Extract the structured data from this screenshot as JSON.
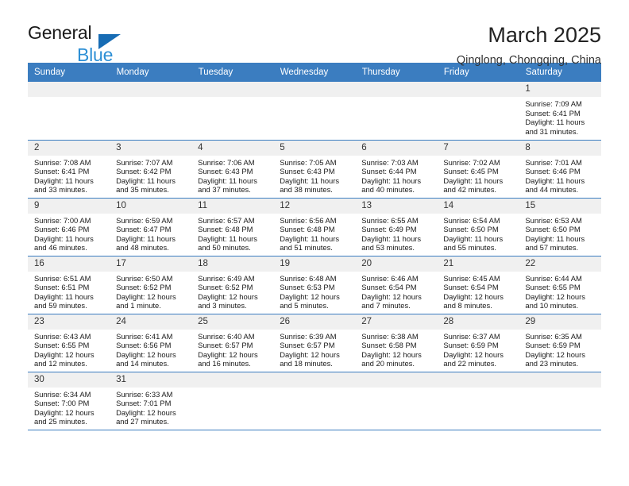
{
  "brand": {
    "name_part1": "General",
    "name_part2": "Blue",
    "accent_color": "#2d8fd5",
    "triangle_color": "#176cb4"
  },
  "header": {
    "title": "March 2025",
    "subtitle": "Qinglong, Chongqing, China"
  },
  "theme": {
    "header_band": "#3b7dc0",
    "daynum_bg": "#f0f0f0",
    "row_border": "#3b7dc0"
  },
  "weekdays": [
    "Sunday",
    "Monday",
    "Tuesday",
    "Wednesday",
    "Thursday",
    "Friday",
    "Saturday"
  ],
  "labels": {
    "sunrise": "Sunrise:",
    "sunset": "Sunset:",
    "daylight": "Daylight:"
  },
  "weeks": [
    [
      {
        "day": "",
        "blank": true
      },
      {
        "day": "",
        "blank": true
      },
      {
        "day": "",
        "blank": true
      },
      {
        "day": "",
        "blank": true
      },
      {
        "day": "",
        "blank": true
      },
      {
        "day": "",
        "blank": true
      },
      {
        "day": "1",
        "sunrise": "Sunrise: 7:09 AM",
        "sunset": "Sunset: 6:41 PM",
        "daylight1": "Daylight: 11 hours",
        "daylight2": "and 31 minutes."
      }
    ],
    [
      {
        "day": "2",
        "sunrise": "Sunrise: 7:08 AM",
        "sunset": "Sunset: 6:41 PM",
        "daylight1": "Daylight: 11 hours",
        "daylight2": "and 33 minutes."
      },
      {
        "day": "3",
        "sunrise": "Sunrise: 7:07 AM",
        "sunset": "Sunset: 6:42 PM",
        "daylight1": "Daylight: 11 hours",
        "daylight2": "and 35 minutes."
      },
      {
        "day": "4",
        "sunrise": "Sunrise: 7:06 AM",
        "sunset": "Sunset: 6:43 PM",
        "daylight1": "Daylight: 11 hours",
        "daylight2": "and 37 minutes."
      },
      {
        "day": "5",
        "sunrise": "Sunrise: 7:05 AM",
        "sunset": "Sunset: 6:43 PM",
        "daylight1": "Daylight: 11 hours",
        "daylight2": "and 38 minutes."
      },
      {
        "day": "6",
        "sunrise": "Sunrise: 7:03 AM",
        "sunset": "Sunset: 6:44 PM",
        "daylight1": "Daylight: 11 hours",
        "daylight2": "and 40 minutes."
      },
      {
        "day": "7",
        "sunrise": "Sunrise: 7:02 AM",
        "sunset": "Sunset: 6:45 PM",
        "daylight1": "Daylight: 11 hours",
        "daylight2": "and 42 minutes."
      },
      {
        "day": "8",
        "sunrise": "Sunrise: 7:01 AM",
        "sunset": "Sunset: 6:46 PM",
        "daylight1": "Daylight: 11 hours",
        "daylight2": "and 44 minutes."
      }
    ],
    [
      {
        "day": "9",
        "sunrise": "Sunrise: 7:00 AM",
        "sunset": "Sunset: 6:46 PM",
        "daylight1": "Daylight: 11 hours",
        "daylight2": "and 46 minutes."
      },
      {
        "day": "10",
        "sunrise": "Sunrise: 6:59 AM",
        "sunset": "Sunset: 6:47 PM",
        "daylight1": "Daylight: 11 hours",
        "daylight2": "and 48 minutes."
      },
      {
        "day": "11",
        "sunrise": "Sunrise: 6:57 AM",
        "sunset": "Sunset: 6:48 PM",
        "daylight1": "Daylight: 11 hours",
        "daylight2": "and 50 minutes."
      },
      {
        "day": "12",
        "sunrise": "Sunrise: 6:56 AM",
        "sunset": "Sunset: 6:48 PM",
        "daylight1": "Daylight: 11 hours",
        "daylight2": "and 51 minutes."
      },
      {
        "day": "13",
        "sunrise": "Sunrise: 6:55 AM",
        "sunset": "Sunset: 6:49 PM",
        "daylight1": "Daylight: 11 hours",
        "daylight2": "and 53 minutes."
      },
      {
        "day": "14",
        "sunrise": "Sunrise: 6:54 AM",
        "sunset": "Sunset: 6:50 PM",
        "daylight1": "Daylight: 11 hours",
        "daylight2": "and 55 minutes."
      },
      {
        "day": "15",
        "sunrise": "Sunrise: 6:53 AM",
        "sunset": "Sunset: 6:50 PM",
        "daylight1": "Daylight: 11 hours",
        "daylight2": "and 57 minutes."
      }
    ],
    [
      {
        "day": "16",
        "sunrise": "Sunrise: 6:51 AM",
        "sunset": "Sunset: 6:51 PM",
        "daylight1": "Daylight: 11 hours",
        "daylight2": "and 59 minutes."
      },
      {
        "day": "17",
        "sunrise": "Sunrise: 6:50 AM",
        "sunset": "Sunset: 6:52 PM",
        "daylight1": "Daylight: 12 hours",
        "daylight2": "and 1 minute."
      },
      {
        "day": "18",
        "sunrise": "Sunrise: 6:49 AM",
        "sunset": "Sunset: 6:52 PM",
        "daylight1": "Daylight: 12 hours",
        "daylight2": "and 3 minutes."
      },
      {
        "day": "19",
        "sunrise": "Sunrise: 6:48 AM",
        "sunset": "Sunset: 6:53 PM",
        "daylight1": "Daylight: 12 hours",
        "daylight2": "and 5 minutes."
      },
      {
        "day": "20",
        "sunrise": "Sunrise: 6:46 AM",
        "sunset": "Sunset: 6:54 PM",
        "daylight1": "Daylight: 12 hours",
        "daylight2": "and 7 minutes."
      },
      {
        "day": "21",
        "sunrise": "Sunrise: 6:45 AM",
        "sunset": "Sunset: 6:54 PM",
        "daylight1": "Daylight: 12 hours",
        "daylight2": "and 8 minutes."
      },
      {
        "day": "22",
        "sunrise": "Sunrise: 6:44 AM",
        "sunset": "Sunset: 6:55 PM",
        "daylight1": "Daylight: 12 hours",
        "daylight2": "and 10 minutes."
      }
    ],
    [
      {
        "day": "23",
        "sunrise": "Sunrise: 6:43 AM",
        "sunset": "Sunset: 6:55 PM",
        "daylight1": "Daylight: 12 hours",
        "daylight2": "and 12 minutes."
      },
      {
        "day": "24",
        "sunrise": "Sunrise: 6:41 AM",
        "sunset": "Sunset: 6:56 PM",
        "daylight1": "Daylight: 12 hours",
        "daylight2": "and 14 minutes."
      },
      {
        "day": "25",
        "sunrise": "Sunrise: 6:40 AM",
        "sunset": "Sunset: 6:57 PM",
        "daylight1": "Daylight: 12 hours",
        "daylight2": "and 16 minutes."
      },
      {
        "day": "26",
        "sunrise": "Sunrise: 6:39 AM",
        "sunset": "Sunset: 6:57 PM",
        "daylight1": "Daylight: 12 hours",
        "daylight2": "and 18 minutes."
      },
      {
        "day": "27",
        "sunrise": "Sunrise: 6:38 AM",
        "sunset": "Sunset: 6:58 PM",
        "daylight1": "Daylight: 12 hours",
        "daylight2": "and 20 minutes."
      },
      {
        "day": "28",
        "sunrise": "Sunrise: 6:37 AM",
        "sunset": "Sunset: 6:59 PM",
        "daylight1": "Daylight: 12 hours",
        "daylight2": "and 22 minutes."
      },
      {
        "day": "29",
        "sunrise": "Sunrise: 6:35 AM",
        "sunset": "Sunset: 6:59 PM",
        "daylight1": "Daylight: 12 hours",
        "daylight2": "and 23 minutes."
      }
    ],
    [
      {
        "day": "30",
        "sunrise": "Sunrise: 6:34 AM",
        "sunset": "Sunset: 7:00 PM",
        "daylight1": "Daylight: 12 hours",
        "daylight2": "and 25 minutes."
      },
      {
        "day": "31",
        "sunrise": "Sunrise: 6:33 AM",
        "sunset": "Sunset: 7:01 PM",
        "daylight1": "Daylight: 12 hours",
        "daylight2": "and 27 minutes."
      },
      {
        "day": "",
        "blank": true,
        "empty": true
      },
      {
        "day": "",
        "blank": true,
        "empty": true
      },
      {
        "day": "",
        "blank": true,
        "empty": true
      },
      {
        "day": "",
        "blank": true,
        "empty": true
      },
      {
        "day": "",
        "blank": true,
        "empty": true
      }
    ]
  ]
}
